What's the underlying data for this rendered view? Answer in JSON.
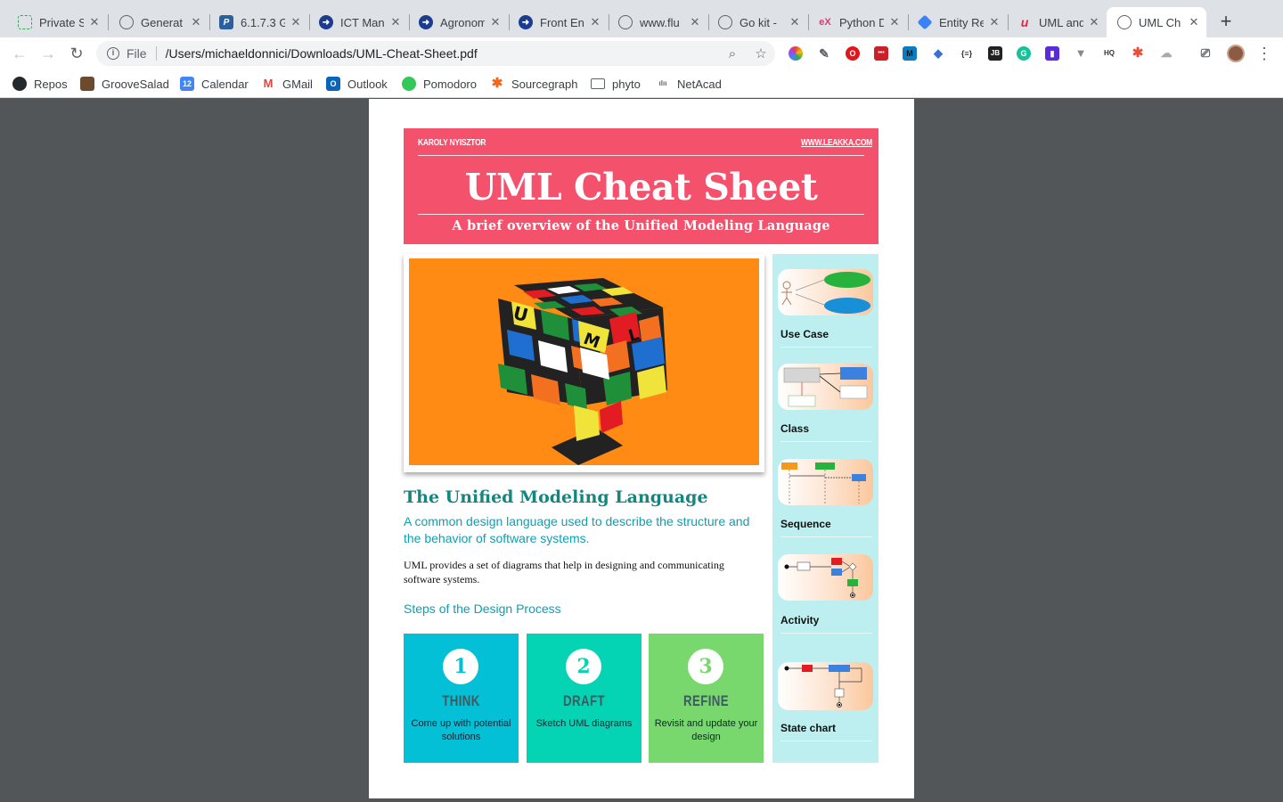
{
  "tabs": [
    {
      "title": "Private S",
      "icon": "doc-icon",
      "color": "#34a853"
    },
    {
      "title": "Generat",
      "icon": "globe-icon",
      "color": "#5f6368"
    },
    {
      "title": "6.1.7.3 G",
      "icon": "p-icon",
      "color": "#2c5f9e"
    },
    {
      "title": "ICT Man",
      "icon": "arrow-icon",
      "color": "#1a3d8f"
    },
    {
      "title": "Agronom",
      "icon": "arrow-icon",
      "color": "#1a3d8f"
    },
    {
      "title": "Front En",
      "icon": "arrow-icon",
      "color": "#1a3d8f"
    },
    {
      "title": "www.flu",
      "icon": "globe-icon",
      "color": "#5f6368"
    },
    {
      "title": "Go kit -",
      "icon": "globe-icon",
      "color": "#5f6368"
    },
    {
      "title": "Python D",
      "icon": "edx-icon",
      "color": "#d23d7a"
    },
    {
      "title": "Entity Re",
      "icon": "diamond-icon",
      "color": "#3b82f6"
    },
    {
      "title": "UML and",
      "icon": "udemy-icon",
      "color": "#e5273e"
    },
    {
      "title": "UML Ch",
      "icon": "globe-icon",
      "color": "#5f6368",
      "active": true
    }
  ],
  "omnibox": {
    "scheme": "File",
    "url": "/Users/michaeldonnici/Downloads/UML-Cheat-Sheet.pdf"
  },
  "bookmarks": [
    {
      "label": "Repos",
      "icon": "github-icon",
      "color": "#24292e"
    },
    {
      "label": "GrooveSalad",
      "icon": "groovesalad-icon",
      "color": "#6b4a2e"
    },
    {
      "label": "Calendar",
      "icon": "calendar-icon",
      "color": "#4285f4",
      "text": "12"
    },
    {
      "label": "GMail",
      "icon": "gmail-icon",
      "color": "#ea4335",
      "text": "M"
    },
    {
      "label": "Outlook",
      "icon": "outlook-icon",
      "color": "#0a64b8",
      "text": "O"
    },
    {
      "label": "Pomodoro",
      "icon": "pomodoro-icon",
      "color": "#34c759"
    },
    {
      "label": "Sourcegraph",
      "icon": "sourcegraph-icon",
      "color": "#f96316"
    },
    {
      "label": "phyto",
      "icon": "folder-icon",
      "color": "#5f6368"
    },
    {
      "label": "NetAcad",
      "icon": "cisco-icon",
      "color": "#5f6368"
    }
  ],
  "pdf": {
    "author": "KAROLY NYISZTOR",
    "website": "WWW.LEAKKA.COM",
    "title": "UML Cheat Sheet",
    "subtitle": "A brief overview of the Unified Modeling Language",
    "cube_letters": [
      "U",
      "M",
      "L"
    ],
    "section_title": "The Unified Modeling Language",
    "section_lead": "A common design language used to describe the structure and the behavior of software systems.",
    "body": "UML provides a set of diagrams that help in designing and communicating software systems.",
    "steps_title": "Steps of the Design Process",
    "steps": [
      {
        "num": "1",
        "label": "THINK",
        "desc": "Come up with potential solutions",
        "color": "#03c0d6"
      },
      {
        "num": "2",
        "label": "DRAFT",
        "desc": "Sketch UML diagrams",
        "color": "#05d4b4"
      },
      {
        "num": "3",
        "label": "REFINE",
        "desc": "Revisit and update your design",
        "color": "#78d86e"
      }
    ],
    "diagrams": [
      {
        "label": "Use Case"
      },
      {
        "label": "Class"
      },
      {
        "label": "Sequence"
      },
      {
        "label": "Activity"
      },
      {
        "label": "State chart"
      }
    ]
  }
}
